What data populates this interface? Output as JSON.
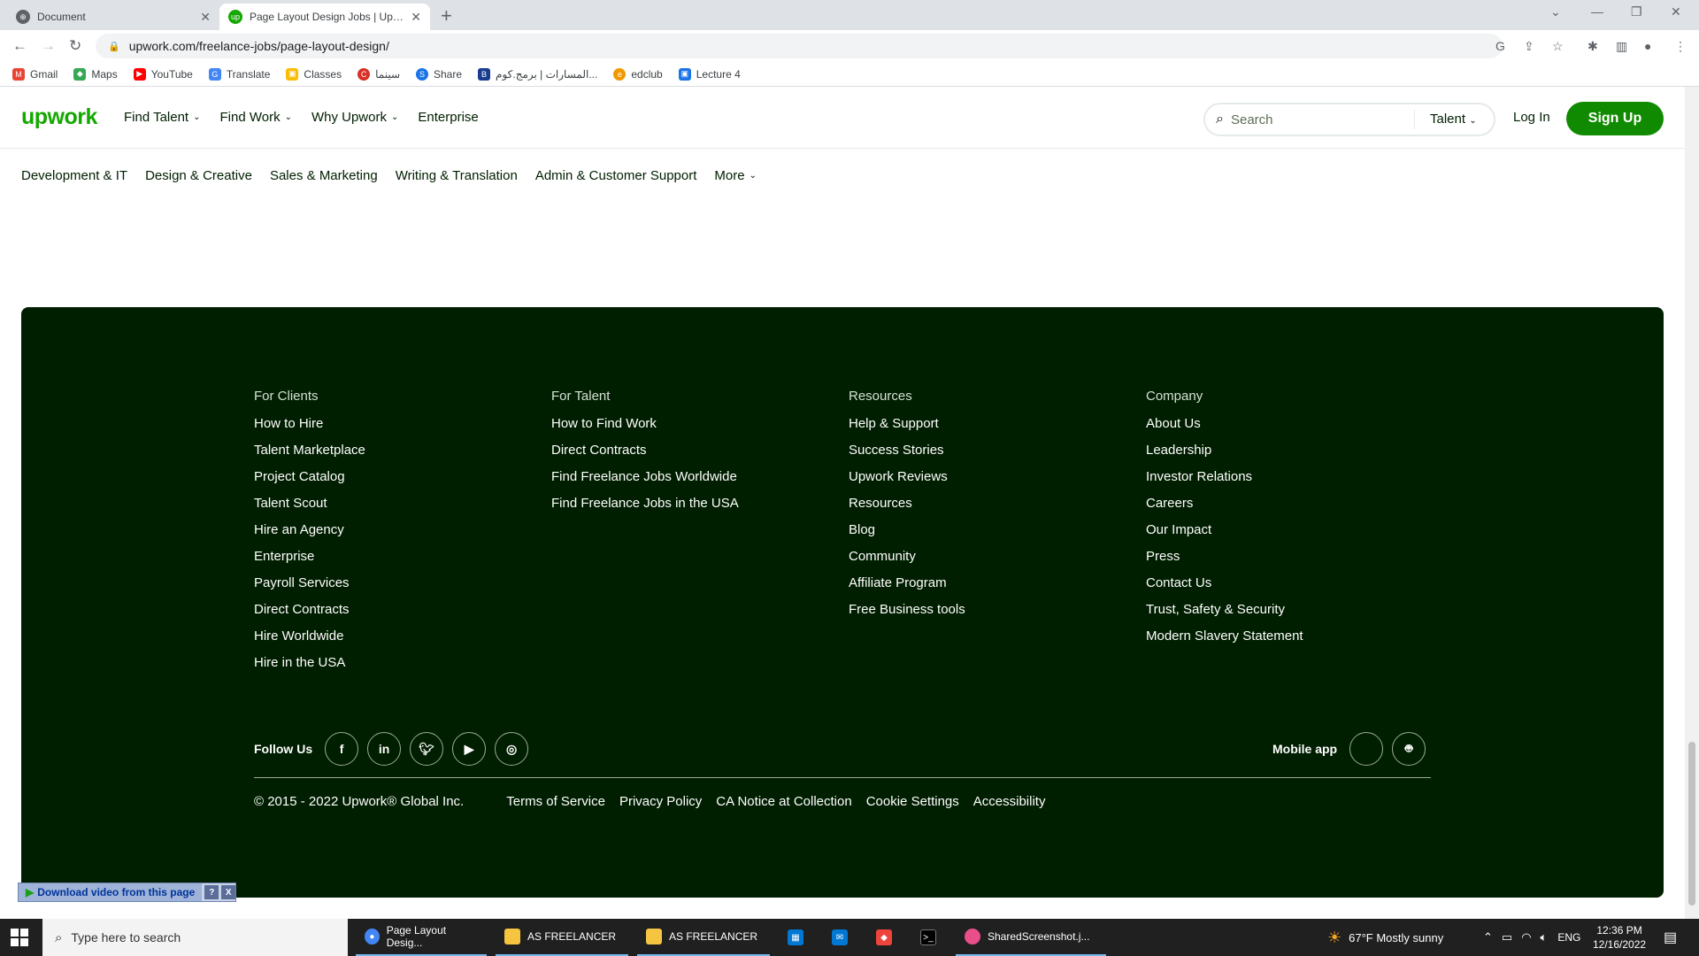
{
  "browser": {
    "tabs": [
      {
        "title": "Document",
        "active": false
      },
      {
        "title": "Page Layout Design Jobs | Upwork",
        "active": true
      }
    ],
    "url": "upwork.com/freelance-jobs/page-layout-design/",
    "bookmarks": [
      "Gmail",
      "Maps",
      "YouTube",
      "Translate",
      "Classes",
      "سينما",
      "Share",
      "المسارات | برمج.كوم...",
      "edclub",
      "Lecture 4"
    ]
  },
  "header": {
    "logo": "upwork",
    "nav": [
      "Find Talent",
      "Find Work",
      "Why Upwork",
      "Enterprise"
    ],
    "search_placeholder": "Search",
    "search_scope": "Talent",
    "login": "Log In",
    "signup": "Sign Up"
  },
  "categories": [
    "Development & IT",
    "Design & Creative",
    "Sales & Marketing",
    "Writing & Translation",
    "Admin & Customer Support",
    "More"
  ],
  "footer": {
    "columns": [
      {
        "heading": "For Clients",
        "links": [
          "How to Hire",
          "Talent Marketplace",
          "Project Catalog",
          "Talent Scout",
          "Hire an Agency",
          "Enterprise",
          "Payroll Services",
          "Direct Contracts",
          "Hire Worldwide",
          "Hire in the USA"
        ]
      },
      {
        "heading": "For Talent",
        "links": [
          "How to Find Work",
          "Direct Contracts",
          "Find Freelance Jobs Worldwide",
          "Find Freelance Jobs in the USA"
        ]
      },
      {
        "heading": "Resources",
        "links": [
          "Help & Support",
          "Success Stories",
          "Upwork Reviews",
          "Resources",
          "Blog",
          "Community",
          "Affiliate Program",
          "Free Business tools"
        ]
      },
      {
        "heading": "Company",
        "links": [
          "About Us",
          "Leadership",
          "Investor Relations",
          "Careers",
          "Our Impact",
          "Press",
          "Contact Us",
          "Trust, Safety & Security",
          "Modern Slavery Statement"
        ]
      }
    ],
    "follow_label": "Follow Us",
    "social_icons": [
      "facebook-icon",
      "linkedin-icon",
      "twitter-icon",
      "youtube-icon",
      "instagram-icon"
    ],
    "mobile_label": "Mobile app",
    "mobile_icons": [
      "apple-icon",
      "android-icon"
    ],
    "copyright": "© 2015 - 2022 Upwork® Global Inc.",
    "legal_links": [
      "Terms of Service",
      "Privacy Policy",
      "CA Notice at Collection",
      "Cookie Settings",
      "Accessibility"
    ]
  },
  "download_bar": {
    "label": "Download video from this page",
    "help": "?",
    "close": "X"
  },
  "taskbar": {
    "search_placeholder": "Type here to search",
    "apps": [
      {
        "label": "Page Layout Desig...",
        "icon": "chrome-icon"
      },
      {
        "label": "AS FREELANCER",
        "icon": "folder-icon"
      },
      {
        "label": "AS FREELANCER",
        "icon": "folder-icon"
      },
      {
        "label": "SharedScreenshot.j...",
        "icon": "paint-icon"
      }
    ],
    "weather": "67°F  Mostly sunny",
    "language": "ENG",
    "time": "12:36 PM",
    "date": "12/16/2022"
  },
  "colors": {
    "brand": "#14a800",
    "signup": "#108a00",
    "footer_bg": "#001e00"
  }
}
